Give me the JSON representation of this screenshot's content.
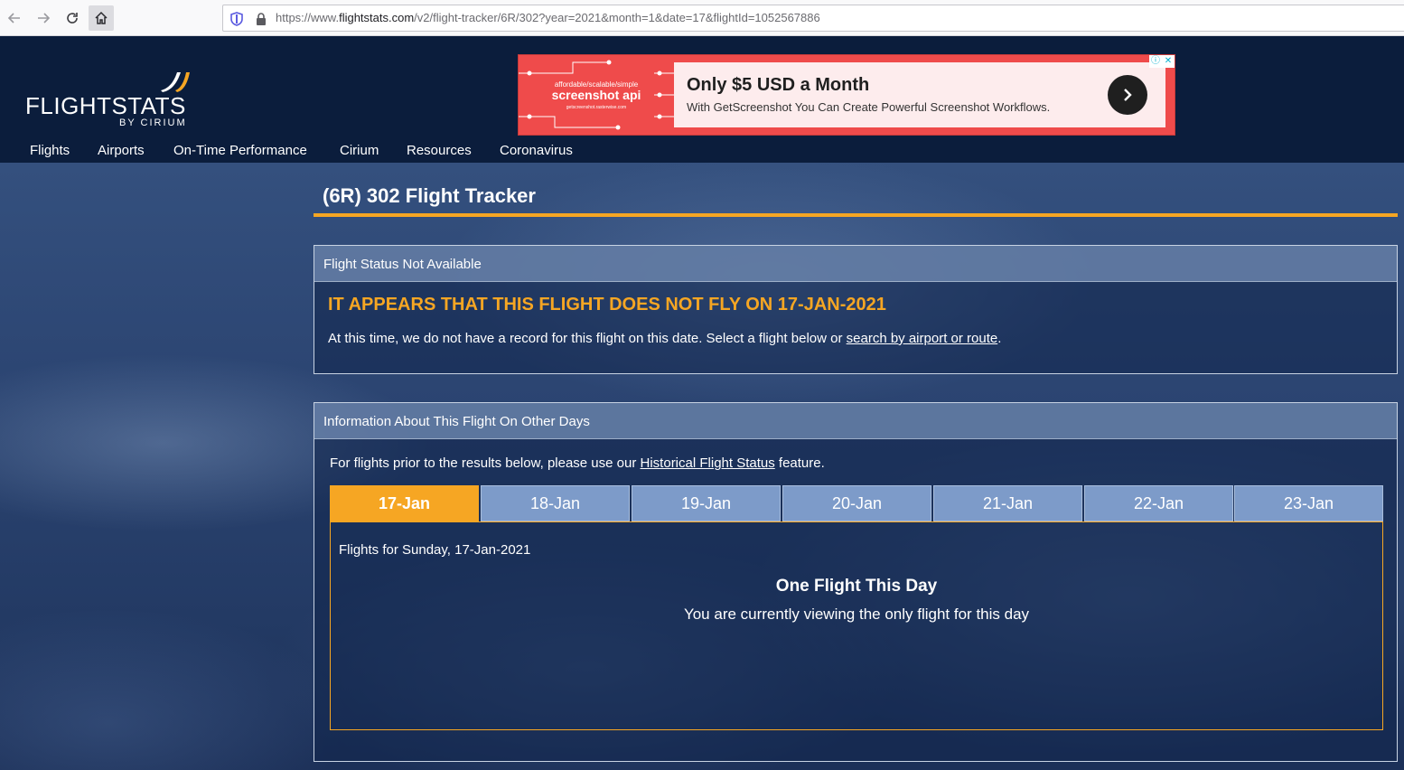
{
  "browser": {
    "url_prefix": "https://www.",
    "url_host": "flightstats.com",
    "url_path": "/v2/flight-tracker/6R/302?year=2021&month=1&date=17&flightId=1052567886"
  },
  "logo": {
    "wordmark": "FLIGHTSTATS",
    "sub": "BY CIRIUM"
  },
  "nav": [
    "Flights",
    "Airports",
    "On-Time Performance",
    "Cirium",
    "Resources",
    "Coronavirus"
  ],
  "ad": {
    "tagline": "affordable/scalable/simple",
    "brand": "screenshot api",
    "small_url": "getscreenshot.rasterwise.com",
    "headline": "Only $5 USD a Month",
    "body": "With GetScreenshot You Can Create Powerful Screenshot Workflows.",
    "info_glyph": "ⓘ",
    "close_glyph": "✕"
  },
  "page": {
    "title": "(6R) 302 Flight Tracker"
  },
  "status_panel": {
    "header": "Flight Status Not Available",
    "title": "IT APPEARS THAT THIS FLIGHT DOES NOT FLY ON 17-JAN-2021",
    "msg_before": "At this time, we do not  have a record for this flight on this date. Select a flight below or ",
    "msg_link": "search by airport or route",
    "msg_after": "."
  },
  "days_panel": {
    "header": "Information About This Flight On Other Days",
    "intro_before": "For flights prior to the results below, please use our ",
    "intro_link": "Historical Flight Status",
    "intro_after": " feature.",
    "tabs": [
      "17-Jan",
      "18-Jan",
      "19-Jan",
      "20-Jan",
      "21-Jan",
      "22-Jan",
      "23-Jan"
    ],
    "active_tab": "17-Jan",
    "flights_date": "Flights for Sunday, 17-Jan-2021",
    "count_heading": "One Flight This Day",
    "count_sub": "You are currently viewing the only flight for this day"
  },
  "colors": {
    "accent": "#f6a623",
    "header_bg": "#0b1d3c",
    "tab_bg": "#7d9bc9"
  }
}
